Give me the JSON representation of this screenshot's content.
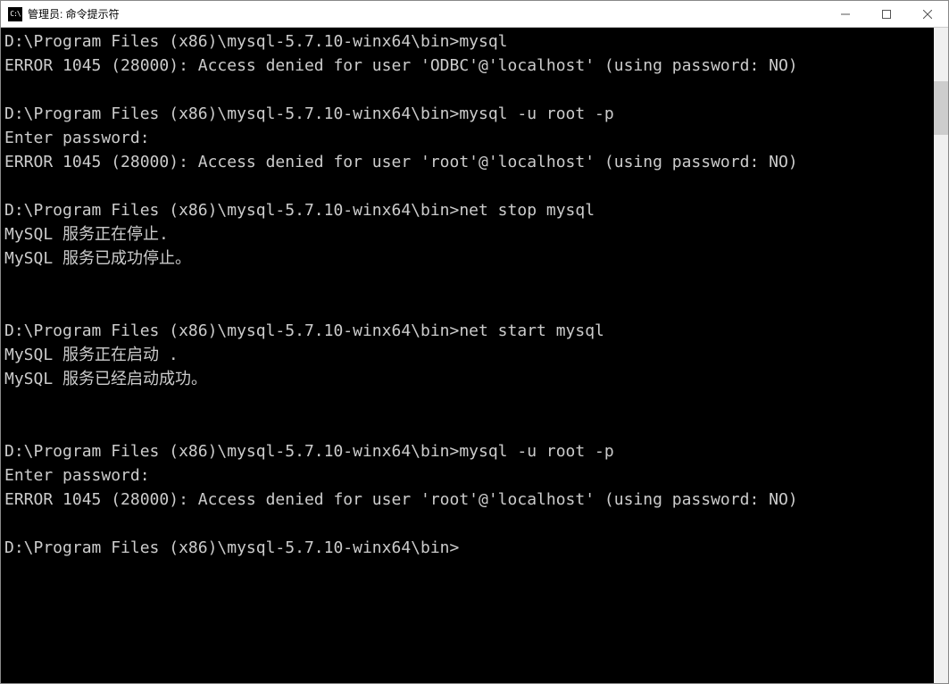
{
  "window": {
    "icon_text": "C:\\",
    "title": "管理员: 命令提示符"
  },
  "terminal": {
    "lines": [
      "D:\\Program Files (x86)\\mysql-5.7.10-winx64\\bin>mysql",
      "ERROR 1045 (28000): Access denied for user 'ODBC'@'localhost' (using password: NO)",
      "",
      "D:\\Program Files (x86)\\mysql-5.7.10-winx64\\bin>mysql -u root -p",
      "Enter password:",
      "ERROR 1045 (28000): Access denied for user 'root'@'localhost' (using password: NO)",
      "",
      "D:\\Program Files (x86)\\mysql-5.7.10-winx64\\bin>net stop mysql",
      "MySQL 服务正在停止.",
      "MySQL 服务已成功停止。",
      "",
      "",
      "D:\\Program Files (x86)\\mysql-5.7.10-winx64\\bin>net start mysql",
      "MySQL 服务正在启动 .",
      "MySQL 服务已经启动成功。",
      "",
      "",
      "D:\\Program Files (x86)\\mysql-5.7.10-winx64\\bin>mysql -u root -p",
      "Enter password:",
      "ERROR 1045 (28000): Access denied for user 'root'@'localhost' (using password: NO)",
      "",
      "D:\\Program Files (x86)\\mysql-5.7.10-winx64\\bin>"
    ]
  }
}
